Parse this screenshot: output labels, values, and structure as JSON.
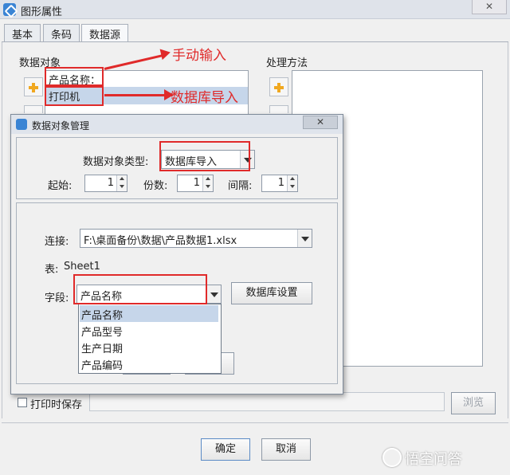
{
  "window": {
    "title": "图形属性",
    "close_label": "✕"
  },
  "tabs": [
    {
      "label": "基本"
    },
    {
      "label": "条码"
    },
    {
      "label": "数据源",
      "active": true
    }
  ],
  "data_objects": {
    "label": "数据对象",
    "items": [
      "产品名称：",
      "打印机"
    ]
  },
  "processing": {
    "label": "处理方法"
  },
  "annotations": {
    "manual_input": "手动输入",
    "db_import": "数据库导入"
  },
  "dialog": {
    "title": "数据对象管理",
    "close_label": "✕",
    "type_label": "数据对象类型:",
    "type_value": "数据库导入",
    "start_label": "起始:",
    "start_value": "1",
    "copies_label": "份数:",
    "copies_value": "1",
    "interval_label": "间隔:",
    "interval_value": "1",
    "connection_label": "连接:",
    "connection_value": "F:\\桌面备份\\数据\\产品数据1.xlsx",
    "table_label": "表:",
    "table_value": "Sheet1",
    "field_label": "字段:",
    "field_value": "产品名称",
    "db_settings_button": "数据库设置",
    "field_options": [
      "产品名称",
      "产品型号",
      "生产日期",
      "产品编码"
    ]
  },
  "print_save": {
    "label": "打印时保存"
  },
  "browse_button": "浏览",
  "ok_button": "确定",
  "cancel_button": "取消",
  "watermark": "悟空问答",
  "colors": {
    "annotation": "#e02a2a",
    "selection": "#c6d6ea",
    "accent": "#3a84d4"
  }
}
